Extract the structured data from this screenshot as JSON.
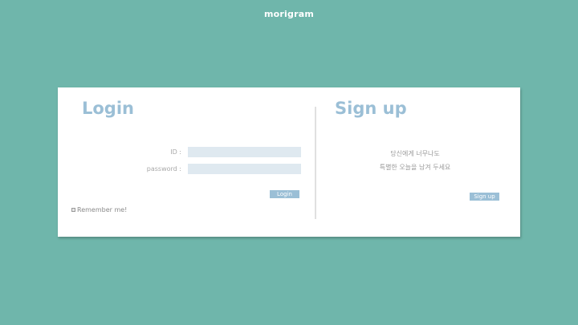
{
  "brand": "morigram",
  "login": {
    "title": "Login",
    "id_label": "ID :",
    "password_label": "password :",
    "id_value": "",
    "password_value": "",
    "button_label": "Login",
    "remember_label": "Remember me!"
  },
  "signup": {
    "title": "Sign up",
    "tagline_line1": "당신에게 너무나도",
    "tagline_line2": "특별한 오늘을 남겨 두세요",
    "button_label": "Sign up"
  },
  "colors": {
    "background": "#6fb6ab",
    "accent": "#9bbfd6",
    "input_bg": "#dfe9f0"
  }
}
